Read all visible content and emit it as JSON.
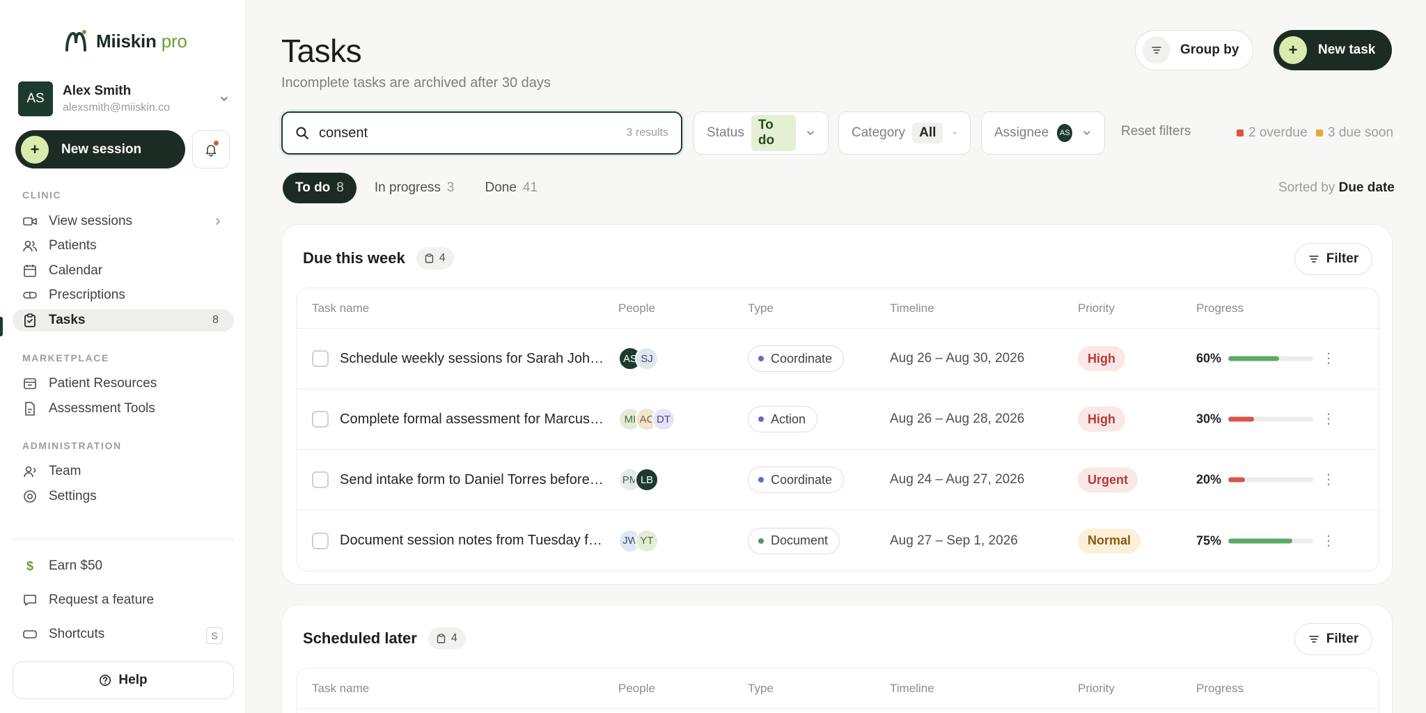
{
  "brand": {
    "name": "Miiskin",
    "suffix": "pro"
  },
  "user": {
    "initials": "AS",
    "name": "Alex Smith",
    "email": "alexsmith@miiskin.co"
  },
  "sidebar": {
    "new_session": "New session",
    "sections": {
      "clinic": "CLINIC",
      "marketplace": "MARKETPLACE",
      "administration": "ADMINISTRATION"
    },
    "items": {
      "view_sessions": "View sessions",
      "patients": "Patients",
      "calendar": "Calendar",
      "prescriptions": "Prescriptions",
      "tasks": "Tasks",
      "tasks_count": "8",
      "patient_resources": "Patient Resources",
      "assessment_tools": "Assessment Tools",
      "team": "Team",
      "settings": "Settings"
    },
    "footer": {
      "earn": "Earn $50",
      "request": "Request a feature",
      "shortcuts": "Shortcuts",
      "shortcut_key": "S",
      "help": "Help"
    }
  },
  "header": {
    "title": "Tasks",
    "subtitle": "Incomplete tasks are archived after 30 days",
    "group_by": "Group by",
    "new_task": "New task"
  },
  "search": {
    "value": "consent",
    "results": "3 results"
  },
  "filters": {
    "status_label": "Status",
    "status_value": "To do",
    "category_label": "Category",
    "category_value": "All",
    "assignee_label": "Assignee",
    "assignee_initials": "AS",
    "reset": "Reset filters",
    "overdue": "2 overdue",
    "due_soon": "3 due soon"
  },
  "tabs": [
    {
      "label": "To do",
      "count": "8"
    },
    {
      "label": "In progress",
      "count": "3"
    },
    {
      "label": "Done",
      "count": "41"
    }
  ],
  "sort": {
    "prefix": "Sorted by",
    "value": "Due date"
  },
  "columns": {
    "task": "Task name",
    "people": "People",
    "type": "Type",
    "timeline": "Timeline",
    "priority": "Priority",
    "progress": "Progress"
  },
  "groups": [
    {
      "title": "Due this week",
      "count": "4",
      "filter": "Filter",
      "rows": [
        {
          "name": "Schedule weekly sessions for Sarah Johanson",
          "people": [
            "AS",
            "SJ"
          ],
          "type": "Coordinate",
          "timeline": "Aug 26 – Aug 30, 2026",
          "priority": "High",
          "progress": "60%"
        },
        {
          "name": "Complete formal assessment for Marcus Lee",
          "people": [
            "MI",
            "AC",
            "DT"
          ],
          "type": "Action",
          "timeline": "Aug 26 – Aug 28, 2026",
          "priority": "High",
          "progress": "30%"
        },
        {
          "name": "Send intake form to Daniel Torres before session",
          "people": [
            "PM",
            "LB"
          ],
          "type": "Coordinate",
          "timeline": "Aug 24 – Aug 27, 2026",
          "priority": "Urgent",
          "progress": "20%"
        },
        {
          "name": "Document session notes from Tuesday follow-up",
          "people": [
            "JW",
            "YT"
          ],
          "type": "Document",
          "timeline": "Aug 27 – Sep 1, 2026",
          "priority": "Normal",
          "progress": "75%"
        }
      ]
    },
    {
      "title": "Scheduled later",
      "count": "4",
      "filter": "Filter"
    }
  ],
  "colors": {
    "brand_dark": "#1d2b25",
    "accent_lime": "#d9ecae",
    "overdue": "#d9573d",
    "due_soon": "#e3a93a",
    "progress_good": "#5caa63",
    "progress_low": "#d9534f"
  }
}
